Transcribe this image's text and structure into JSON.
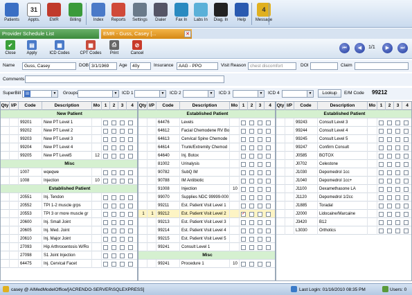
{
  "toolbar": [
    {
      "name": "patients",
      "label": "Patients",
      "color": "#3a6fc4"
    },
    {
      "name": "appts",
      "label": "Appts.",
      "color": "#555"
    },
    {
      "name": "emr",
      "label": "EMR",
      "color": "#c03a2b"
    },
    {
      "name": "billing",
      "label": "Billing",
      "color": "#3a9a3a"
    },
    {
      "name": "index",
      "label": "Index",
      "color": "#4a7ac8"
    },
    {
      "name": "reports",
      "label": "Reports",
      "color": "#d04a3a"
    },
    {
      "name": "settings",
      "label": "Settings",
      "color": "#6a7a8a"
    },
    {
      "name": "dialer",
      "label": "Dialer",
      "color": "#556"
    },
    {
      "name": "fax-in",
      "label": "Fax In",
      "color": "#2a8ac0"
    },
    {
      "name": "labs-in",
      "label": "Labs In",
      "color": "#5ab0d8"
    },
    {
      "name": "diag-in",
      "label": "Diag. In",
      "color": "#222"
    },
    {
      "name": "help",
      "label": "Help",
      "color": "#2a5ab0"
    },
    {
      "name": "message",
      "label": "Message",
      "color": "#e0b020"
    }
  ],
  "appts_icon_text": "31",
  "message_count": "4",
  "tabs": {
    "tab1": "Provider Schedule List",
    "tab2": "EMR - Guss, Casey  [..."
  },
  "actions": [
    {
      "name": "close",
      "label": "Close",
      "color": "#3aa03a",
      "glyph": "✔"
    },
    {
      "name": "apply",
      "label": "Apply",
      "color": "#4a7ac8",
      "glyph": "▤"
    },
    {
      "name": "icd-codes",
      "label": "ICD Codes",
      "color": "#4a7ac8",
      "glyph": "▦"
    },
    {
      "name": "cpt-codes",
      "label": "CPT Codes",
      "color": "#c84a3a",
      "glyph": "▦"
    },
    {
      "name": "print",
      "label": "Print",
      "color": "#666",
      "glyph": "⎙"
    },
    {
      "name": "cancel",
      "label": "Cancel",
      "color": "#c83a2a",
      "glyph": "⊘"
    }
  ],
  "pager": "1/1",
  "patient": {
    "name_label": "Name",
    "name": "Guss, Casey",
    "dob_label": "DOB",
    "dob": "3/1/1969",
    "age_label": "Age",
    "age": "40y",
    "insurance_label": "Insurance",
    "insurance": "AAG - PPO",
    "visit_label": "Visit Reason",
    "visit": "chest discomfort",
    "doi_label": "DOI",
    "doi": "",
    "claim_label": "Claim",
    "claim": ""
  },
  "comments_label": "Comments",
  "codes": {
    "superbill_label": "SuperBill",
    "superbill": "III",
    "groups_label": "Groups",
    "icd1_label": "ICD 1",
    "icd2_label": "ICD 2",
    "icd3_label": "ICD 3",
    "icd4_label": "ICD 4",
    "lookup_label": "Lookup",
    "em_label": "E/M Code",
    "em": "99212"
  },
  "headers": [
    "Qty",
    "I/P",
    "Code",
    "Description",
    "Mo",
    "1",
    "2",
    "3",
    "4"
  ],
  "grid1": [
    {
      "t": "sec",
      "d": "New Patient"
    },
    {
      "code": "99201",
      "d": "New PT Level 1",
      "mo": ""
    },
    {
      "code": "99202",
      "d": "New PT Level 2",
      "mo": ""
    },
    {
      "code": "99203",
      "d": "New PT Level 3",
      "mo": ""
    },
    {
      "code": "99204",
      "d": "New PT Level 4",
      "mo": ""
    },
    {
      "code": "99205",
      "d": "New PT Level5",
      "mo": "12"
    },
    {
      "t": "sec",
      "d": "Misc"
    },
    {
      "code": "1007",
      "d": "wqeqwe",
      "mo": ""
    },
    {
      "code": "1008",
      "d": "Injection",
      "mo": "10"
    },
    {
      "t": "sec",
      "d": "Established Patient"
    },
    {
      "code": "20551",
      "d": "Inj. Tendon",
      "mo": ""
    },
    {
      "code": "20552",
      "d": "TPI 1-2 muscle grps",
      "mo": ""
    },
    {
      "code": "20553",
      "d": "TPI 3 or more muscle gr",
      "mo": ""
    },
    {
      "code": "20600",
      "d": "Inj. Small Joint",
      "mo": ""
    },
    {
      "code": "20605",
      "d": "Inj. Med. Joint",
      "mo": ""
    },
    {
      "code": "20610",
      "d": "Inj. Major Joint",
      "mo": ""
    },
    {
      "code": "27093",
      "d": "Hip Arthrocentosis W/Ro",
      "mo": ""
    },
    {
      "code": "27098",
      "d": "S1 Joint Injection",
      "mo": ""
    },
    {
      "code": "64475",
      "d": "Inj. Cervical Facet",
      "mo": ""
    }
  ],
  "grid2": [
    {
      "t": "sec",
      "d": "Established Patient"
    },
    {
      "code": "64476",
      "d": "Levels",
      "mo": ""
    },
    {
      "code": "64612",
      "d": "Facial Chemodene RV Bo",
      "mo": ""
    },
    {
      "code": "64613",
      "d": "Cervical Spine Chemode",
      "mo": ""
    },
    {
      "code": "64614",
      "d": "Trunk/Extremity Chemod",
      "mo": ""
    },
    {
      "code": "64640",
      "d": "Inj. Botox",
      "mo": ""
    },
    {
      "code": "81002",
      "d": "Urinalysis",
      "mo": ""
    },
    {
      "code": "90782",
      "d": "SubQ IM",
      "mo": ""
    },
    {
      "code": "90788",
      "d": "IM Antibiotic",
      "mo": ""
    },
    {
      "code": "91008",
      "d": "Injection",
      "mo": "10"
    },
    {
      "code": "99070",
      "d": "Supplies NDC 99999-000",
      "mo": ""
    },
    {
      "code": "99211",
      "d": "Est. Patient Visit Level 1",
      "mo": ""
    },
    {
      "qty": "1",
      "ip": "1",
      "code": "99212",
      "d": "Est. Patient Visit Level 2",
      "mo": "",
      "hl": true,
      "chk": true
    },
    {
      "code": "99213",
      "d": "Est. Patient Visit Level 3",
      "mo": ""
    },
    {
      "code": "99214",
      "d": "Est. Patient Visit Level 4",
      "mo": ""
    },
    {
      "code": "99215",
      "d": "Est. Patient Visit Level 5",
      "mo": ""
    },
    {
      "code": "99241",
      "d": "Consult Level 1",
      "mo": ""
    },
    {
      "t": "sec",
      "d": "Misc"
    },
    {
      "code": "99241",
      "d": "Procedure 1",
      "mo": "10"
    }
  ],
  "grid3": [
    {
      "t": "sec",
      "d": "Established Patient"
    },
    {
      "code": "99243",
      "d": "Consult Level 3",
      "mo": ""
    },
    {
      "code": "99244",
      "d": "Consult Level 4",
      "mo": ""
    },
    {
      "code": "99245",
      "d": "Consult Level 5",
      "mo": ""
    },
    {
      "code": "99247",
      "d": "Confirm Consult",
      "mo": ""
    },
    {
      "code": "J0585",
      "d": "BOTOX",
      "mo": ""
    },
    {
      "code": "J0702",
      "d": "Celestone",
      "mo": ""
    },
    {
      "code": "J1030",
      "d": "Depomedrol 1cc",
      "mo": ""
    },
    {
      "code": "J1040",
      "d": "Depomedrol 1cc+",
      "mo": ""
    },
    {
      "code": "J1100",
      "d": "Dexamethasone LA",
      "mo": ""
    },
    {
      "code": "J1120",
      "d": "Depomedrol 1/2cc",
      "mo": ""
    },
    {
      "code": "J1885",
      "d": "Toradal",
      "mo": ""
    },
    {
      "code": "J2000",
      "d": "Lidocaine/Marcaine",
      "mo": ""
    },
    {
      "code": "J3420",
      "d": "B12",
      "mo": ""
    },
    {
      "code": "L3030",
      "d": "Orthotics",
      "mo": ""
    }
  ],
  "status": {
    "user": "casey @ AIMedModelOffice/[ACRENDO-SERVER\\SQLEXPRESS]",
    "login": "Last Login: 01/16/2010 08:35 PM",
    "users": "Users: 0"
  }
}
